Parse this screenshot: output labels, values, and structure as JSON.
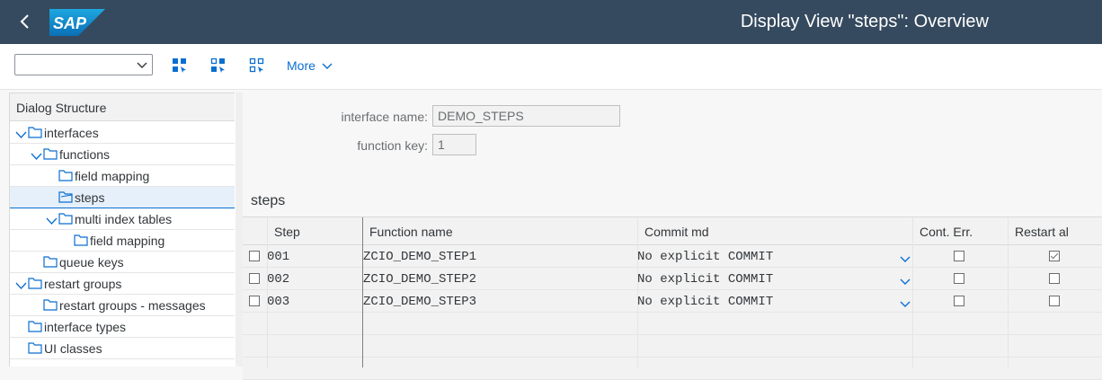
{
  "shell": {
    "title": "Display View \"steps\": Overview",
    "logo_text": "SAP"
  },
  "toolbar": {
    "command_value": "",
    "more_label": "More"
  },
  "dialog_structure": {
    "title": "Dialog Structure",
    "items": [
      {
        "label": "interfaces",
        "level": 0,
        "expanded": true
      },
      {
        "label": "functions",
        "level": 1,
        "expanded": true
      },
      {
        "label": "field mapping",
        "level": 2,
        "expanded": false
      },
      {
        "label": "steps",
        "level": 2,
        "expanded": false,
        "selected": true
      },
      {
        "label": "multi index tables",
        "level": 2,
        "expanded": true
      },
      {
        "label": "field mapping",
        "level": 3,
        "expanded": false
      },
      {
        "label": "queue keys",
        "level": 1,
        "expanded": false
      },
      {
        "label": "restart groups",
        "level": 0,
        "expanded": true
      },
      {
        "label": "restart groups - messages",
        "level": 1,
        "expanded": false
      },
      {
        "label": "interface types",
        "level": 0,
        "expanded": false
      },
      {
        "label": "UI classes",
        "level": 0,
        "expanded": false
      }
    ]
  },
  "header_fields": {
    "interface_name_label": "interface name:",
    "interface_name_value": "DEMO_STEPS",
    "function_key_label": "function key:",
    "function_key_value": "1"
  },
  "table": {
    "title": "steps",
    "columns": [
      "Step",
      "Function name",
      "Commit md",
      "Cont. Err.",
      "Restart al"
    ],
    "rows": [
      {
        "step": "001",
        "function": "ZCIO_DEMO_STEP1",
        "commit": "No explicit COMMIT",
        "cont_err": false,
        "restart": true
      },
      {
        "step": "002",
        "function": "ZCIO_DEMO_STEP2",
        "commit": "No explicit COMMIT",
        "cont_err": false,
        "restart": false
      },
      {
        "step": "003",
        "function": "ZCIO_DEMO_STEP3",
        "commit": "No explicit COMMIT",
        "cont_err": false,
        "restart": false
      }
    ]
  },
  "colors": {
    "shell": "#354a5f",
    "accent": "#0a6ed1",
    "selected_row": "#e5f0fa"
  }
}
